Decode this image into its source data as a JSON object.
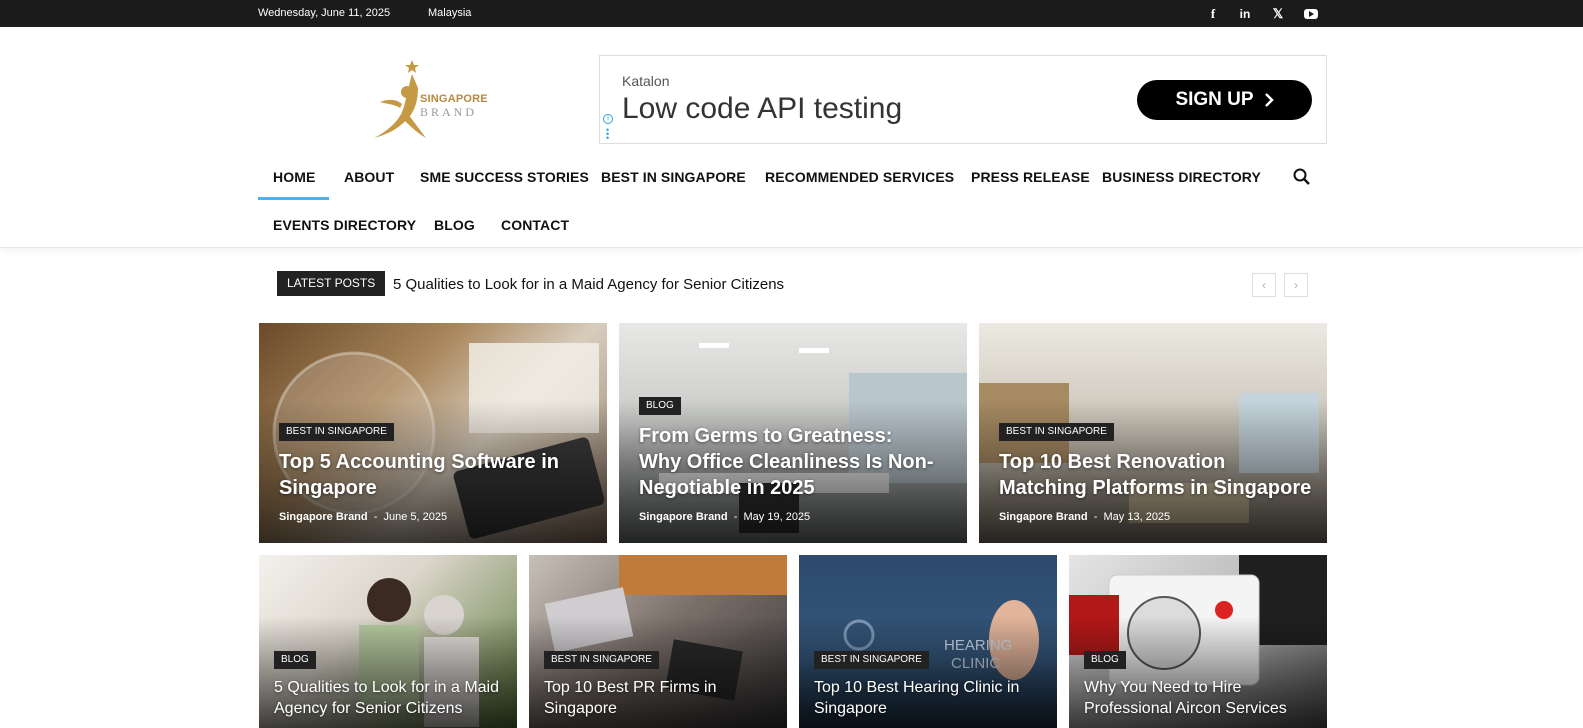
{
  "topbar": {
    "date": "Wednesday, June 11, 2025",
    "region": "Malaysia",
    "social": [
      "facebook-icon",
      "linkedin-icon",
      "x-icon",
      "youtube-icon"
    ]
  },
  "logo": {
    "line1": "SINGAPORE",
    "line2": "BRAND"
  },
  "ad": {
    "brand": "Katalon",
    "headline": "Low code API testing",
    "cta": "SIGN UP"
  },
  "nav": {
    "items": [
      "HOME",
      "ABOUT",
      "SME SUCCESS STORIES",
      "BEST IN SINGAPORE",
      "RECOMMENDED SERVICES",
      "PRESS RELEASE",
      "BUSINESS DIRECTORY",
      "EVENTS DIRECTORY",
      "BLOG",
      "CONTACT"
    ],
    "active": "HOME"
  },
  "ticker": {
    "label": "LATEST POSTS",
    "text": "5 Qualities to Look for in a Maid Agency for Senior Citizens",
    "prev": "‹",
    "next": "›"
  },
  "featured": [
    {
      "tag": "BEST IN SINGAPORE",
      "title": "Top 5 Accounting Software in Singapore",
      "author": "Singapore Brand",
      "date": "June 5, 2025"
    },
    {
      "tag": "BLOG",
      "title": "From Germs to Greatness: Why Office Cleanliness Is Non-Negotiable in 2025",
      "author": "Singapore Brand",
      "date": "May 19, 2025"
    },
    {
      "tag": "BEST IN SINGAPORE",
      "title": "Top 10 Best Renovation Matching Platforms in Singapore",
      "author": "Singapore Brand",
      "date": "May 13, 2025"
    }
  ],
  "secondary": [
    {
      "tag": "BLOG",
      "title": "5 Qualities to Look for in a Maid Agency for Senior Citizens"
    },
    {
      "tag": "BEST IN SINGAPORE",
      "title": "Top 10 Best PR Firms in Singapore"
    },
    {
      "tag": "BEST IN SINGAPORE",
      "title": "Top 10 Best Hearing Clinic in Singapore"
    },
    {
      "tag": "BLOG",
      "title": "Why You Need to Hire Professional Aircon Services"
    }
  ],
  "colors": {
    "accent": "#4db2ec",
    "dark": "#222222",
    "gold": "#b8893a"
  }
}
